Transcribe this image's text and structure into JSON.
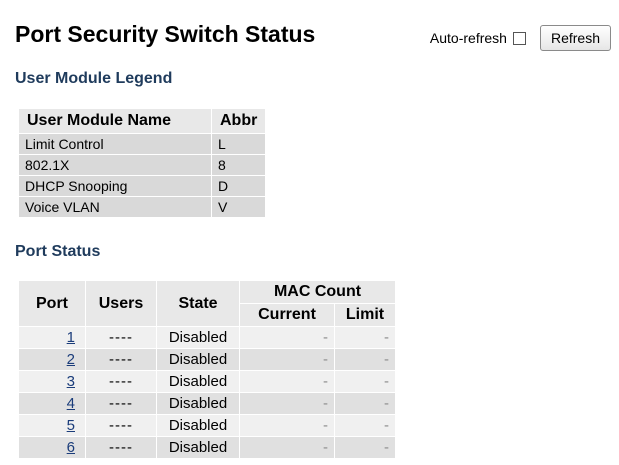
{
  "page": {
    "title": "Port Security Switch Status",
    "auto_refresh_label": "Auto-refresh",
    "auto_refresh_checked": false,
    "refresh_button": "Refresh"
  },
  "legend": {
    "title": "User Module Legend",
    "headers": {
      "name": "User Module Name",
      "abbr": "Abbr"
    },
    "rows": [
      {
        "name": "Limit Control",
        "abbr": "L"
      },
      {
        "name": "802.1X",
        "abbr": "8"
      },
      {
        "name": "DHCP Snooping",
        "abbr": "D"
      },
      {
        "name": "Voice VLAN",
        "abbr": "V"
      }
    ]
  },
  "port_status": {
    "title": "Port Status",
    "headers": {
      "port": "Port",
      "users": "Users",
      "state": "State",
      "mac_count": "MAC Count",
      "current": "Current",
      "limit": "Limit"
    },
    "rows": [
      {
        "port": "1",
        "users": "----",
        "state": "Disabled",
        "current": "-",
        "limit": "-"
      },
      {
        "port": "2",
        "users": "----",
        "state": "Disabled",
        "current": "-",
        "limit": "-"
      },
      {
        "port": "3",
        "users": "----",
        "state": "Disabled",
        "current": "-",
        "limit": "-"
      },
      {
        "port": "4",
        "users": "----",
        "state": "Disabled",
        "current": "-",
        "limit": "-"
      },
      {
        "port": "5",
        "users": "----",
        "state": "Disabled",
        "current": "-",
        "limit": "-"
      },
      {
        "port": "6",
        "users": "----",
        "state": "Disabled",
        "current": "-",
        "limit": "-"
      }
    ]
  }
}
